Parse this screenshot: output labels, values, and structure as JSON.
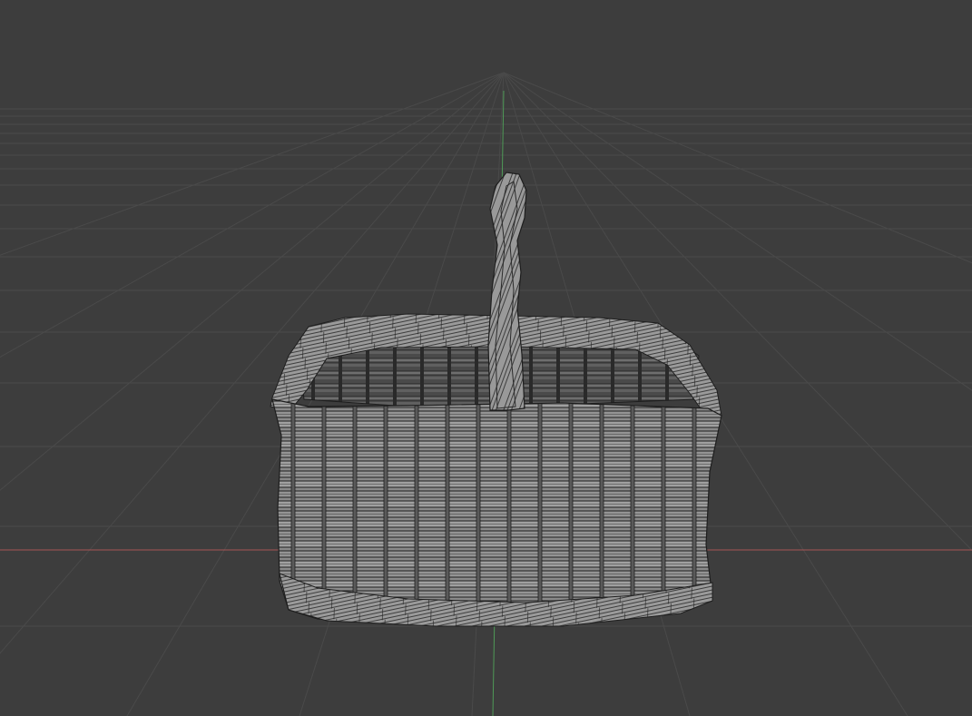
{
  "viewport": {
    "background_color": "#3d3d3d",
    "grid_color": "#4a4a4a",
    "x_axis_color": "#a85555",
    "y_axis_color": "#4f9a57",
    "mesh_fill_color": "#8e8e8e",
    "mesh_wire_color": "#1e1e1e",
    "overlay": "wireframe",
    "object": "wicker-basket"
  }
}
